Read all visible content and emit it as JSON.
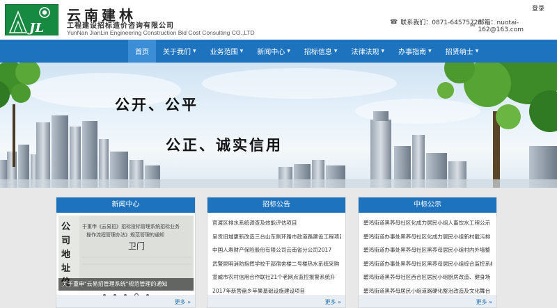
{
  "header": {
    "brand_cn": "云南建林",
    "brand_sub": "工程建设招标造价咨询有限公司",
    "brand_en": "YunNan JianLin Engineering Construction Bid Cost Consulting CO.,LTD",
    "logo_letters": "JL",
    "login": "登录",
    "phone": "联系我们：0871-64575728",
    "email": "邮箱：nuotai-162@163.com"
  },
  "nav": {
    "items": [
      {
        "label": "首页",
        "active": true
      },
      {
        "label": "关于我们"
      },
      {
        "label": "业务范围"
      },
      {
        "label": "新闻中心"
      },
      {
        "label": "招标信息"
      },
      {
        "label": "法律法规"
      },
      {
        "label": "办事指南"
      },
      {
        "label": "招贤纳士"
      }
    ]
  },
  "banner": {
    "slogan1": "公开、公平",
    "slogan2": "公正、诚实信用"
  },
  "panels": {
    "news": {
      "title": "新闻中心",
      "caption": "关于重申\"云易招管理系统\"规范管理的通知",
      "more": "更多 »"
    },
    "tender": {
      "title": "招标公告",
      "items": [
        "官渡区排水系统调查及效能评估项目",
        "呈贡旧城更新改造三台山东侧环路市政道路建设工程项目",
        "中国人寿财产保险股份有限公司云南省分公司2017",
        "武警昆明消防指挥学校干部宿舍楼二号楼热水系统采购",
        "宣威市农村信用合作联社21个老网点监控报警系统升",
        "2017年新营盘乡苹果基础设施建设项目"
      ],
      "more": "更多 »"
    },
    "bid": {
      "title": "中标公示",
      "items": [
        "碧鸡街道黑荞母社区化成力居民小组人畜饮水工程公示",
        "碧鸡街道办事处黑荞母社区化成力居民小组新村截污排",
        "碧鸡街道办事处黑荞母社区黑荞母居民小组村内外墙整",
        "碧鸡街道办事处黑荞母社区黑荞母居民小组综合监控系统安装工程",
        "碧鸡街道黑荞母社区西合区居民小组厨房改造、健身场",
        "碧鸡街道黑荞母居民小组道路硬化整治改造及文化舞台"
      ],
      "more": "更多 »"
    }
  }
}
